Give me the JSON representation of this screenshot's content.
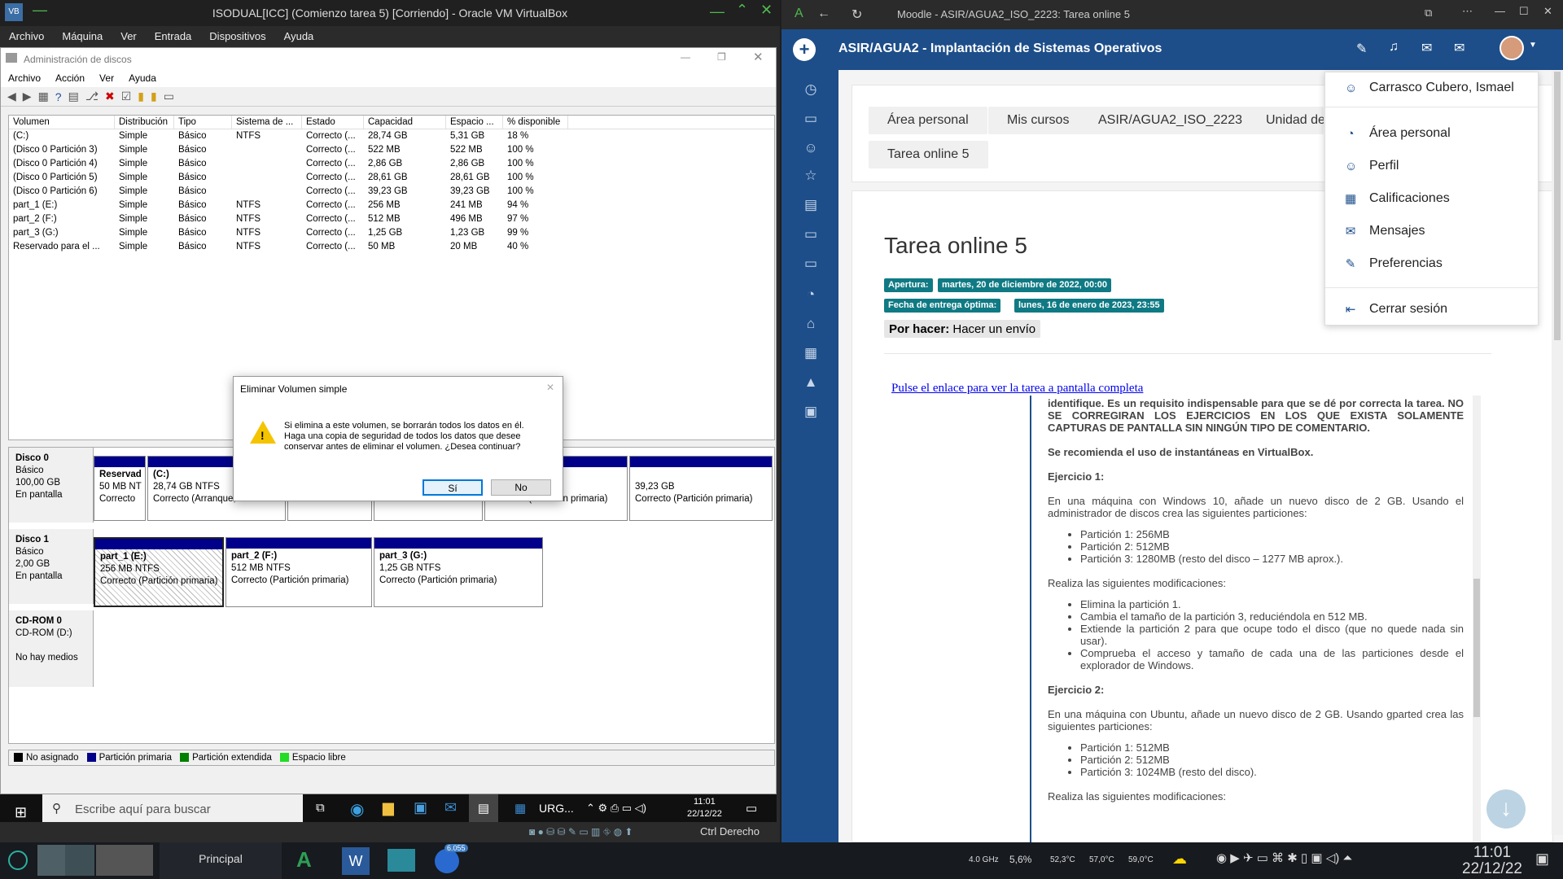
{
  "vbox": {
    "title": "ISODUAL[ICC] (Comienzo tarea 5) [Corriendo] - Oracle VM VirtualBox",
    "menu": [
      "Archivo",
      "Máquina",
      "Ver",
      "Entrada",
      "Dispositivos",
      "Ayuda"
    ],
    "host_key": "Ctrl Derecho"
  },
  "dm": {
    "title": "Administración de discos",
    "menu": [
      "Archivo",
      "Acción",
      "Ver",
      "Ayuda"
    ],
    "columns": [
      "Volumen",
      "Distribución",
      "Tipo",
      "Sistema de ...",
      "Estado",
      "Capacidad",
      "Espacio ...",
      "% disponible"
    ],
    "rows": [
      [
        "(C:)",
        "Simple",
        "Básico",
        "NTFS",
        "Correcto (...",
        "28,74 GB",
        "5,31 GB",
        "18 %"
      ],
      [
        "(Disco 0 Partición 3)",
        "Simple",
        "Básico",
        "",
        "Correcto (...",
        "522 MB",
        "522 MB",
        "100 %"
      ],
      [
        "(Disco 0 Partición 4)",
        "Simple",
        "Básico",
        "",
        "Correcto (...",
        "2,86 GB",
        "2,86 GB",
        "100 %"
      ],
      [
        "(Disco 0 Partición 5)",
        "Simple",
        "Básico",
        "",
        "Correcto (...",
        "28,61 GB",
        "28,61 GB",
        "100 %"
      ],
      [
        "(Disco 0 Partición 6)",
        "Simple",
        "Básico",
        "",
        "Correcto (...",
        "39,23 GB",
        "39,23 GB",
        "100 %"
      ],
      [
        "part_1 (E:)",
        "Simple",
        "Básico",
        "NTFS",
        "Correcto (...",
        "256 MB",
        "241 MB",
        "94 %"
      ],
      [
        "part_2 (F:)",
        "Simple",
        "Básico",
        "NTFS",
        "Correcto (...",
        "512 MB",
        "496 MB",
        "97 %"
      ],
      [
        "part_3 (G:)",
        "Simple",
        "Básico",
        "NTFS",
        "Correcto (...",
        "1,25 GB",
        "1,23 GB",
        "99 %"
      ],
      [
        "Reservado para el ...",
        "Simple",
        "Básico",
        "NTFS",
        "Correcto (...",
        "50 MB",
        "20 MB",
        "40 %"
      ]
    ],
    "disk0": {
      "name": "Disco 0",
      "type": "Básico",
      "size": "100,00 GB",
      "state": "En pantalla",
      "p_res": {
        "name": "Reservad",
        "size": "50 MB NT",
        "state": "Correcto"
      },
      "p_c": {
        "name": "(C:)",
        "size": "28,74 GB NTFS",
        "state": "Correcto (Arranque, ..."
      },
      "p_last": {
        "size": "39,23 GB",
        "state": "Correcto (Partición primaria)"
      },
      "p_mid_state": "Correcto (Partición primaria)"
    },
    "disk1": {
      "name": "Disco 1",
      "type": "Básico",
      "size": "2,00 GB",
      "state": "En pantalla",
      "parts": [
        {
          "name": "part_1 (E:)",
          "size": "256 MB NTFS",
          "state": "Correcto (Partición primaria)"
        },
        {
          "name": "part_2 (F:)",
          "size": "512 MB NTFS",
          "state": "Correcto (Partición primaria)"
        },
        {
          "name": "part_3 (G:)",
          "size": "1,25 GB NTFS",
          "state": "Correcto (Partición primaria)"
        }
      ]
    },
    "cdrom": {
      "name": "CD-ROM 0",
      "drive": "CD-ROM (D:)",
      "media": "No hay medios"
    },
    "legend": [
      "No asignado",
      "Partición primaria",
      "Partición extendida",
      "Espacio libre"
    ]
  },
  "dialog": {
    "title": "Eliminar Volumen simple",
    "line1": "Si elimina a este volumen, se borrarán todos los datos en él.",
    "line2": "Haga una copia de seguridad de todos los datos que desee",
    "line3": "conservar antes de eliminar el volumen. ¿Desea continuar?",
    "yes": "Sí",
    "no": "No"
  },
  "wintb": {
    "search_placeholder": "Escribe aquí para buscar",
    "app_label": "URG...",
    "time": "11:01",
    "date": "22/12/22"
  },
  "browser": {
    "title": "Moodle - ASIR/AGUA2_ISO_2223: Tarea online 5",
    "course": "ASIR/AGUA2 - Implantación de Sistemas Operativos",
    "crumbs": [
      "Área personal",
      "Mis cursos",
      "ASIR/AGUA2_ISO_2223",
      "Unidad de",
      "Tarea online 5"
    ],
    "heading": "Tarea online 5",
    "apertura_label": "Apertura:",
    "apertura_val": "martes, 20 de diciembre de 2022, 00:00",
    "entrega_label": "Fecha de entrega óptima:",
    "entrega_val": "lunes, 16 de enero de 2023, 23:55",
    "todo_label": "Por hacer:",
    "todo_val": "Hacer un envío",
    "link": "Pulse el enlace para ver la tarea a pantalla completa",
    "dropdown": {
      "user": "Carrasco Cubero, Ismael",
      "items": [
        "Área personal",
        "Perfil",
        "Calificaciones",
        "Mensajes",
        "Preferencias"
      ],
      "logout": "Cerrar sesión"
    }
  },
  "task": {
    "p0": "identifique. Es un requisito indispensable para que se dé por correcta la tarea. NO SE CORREGIRAN LOS EJERCICIOS EN LOS QUE EXISTA SOLAMENTE CAPTURAS DE PANTALLA SIN NINGÚN TIPO DE COMENTARIO.",
    "p1": "Se recomienda el uso de instantáneas en VirtualBox.",
    "ej1": "Ejercicio 1:",
    "ej1_text": "En una máquina con Windows 10, añade un nuevo disco de 2 GB. Usando el administrador de discos crea las siguientes particiones:",
    "ej1_list": [
      "Partición 1: 256MB",
      "Partición 2: 512MB",
      "Partición 3: 1280MB (resto del disco – 1277 MB aprox.)."
    ],
    "mods": "Realiza las siguientes modificaciones:",
    "mods_list": [
      "Elimina la partición 1.",
      "Cambia el tamaño de la partición 3, reduciéndola en 512 MB.",
      "Extiende la partición 2 para que ocupe todo el disco (que no quede nada sin usar).",
      "Comprueba el acceso y tamaño de cada una de las particiones desde el explorador de Windows."
    ],
    "ej2": "Ejercicio 2:",
    "ej2_text": "En una máquina con Ubuntu, añade un nuevo disco de 2 GB. Usando gparted crea las siguientes particiones:",
    "ej2_list": [
      "Partición 1: 512MB",
      "Partición 2: 512MB",
      "Partición 3: 1024MB (resto del disco)."
    ],
    "mods2": "Realiza las siguientes modificaciones:"
  },
  "hostbar": {
    "desktop": "Principal",
    "cpu_freq": "4.0 GHz",
    "cpu": "5,6%",
    "t1": "52,3°C",
    "t2": "57,0°C",
    "t3": "59,0°C",
    "time": "11:01",
    "date": "22/12/22",
    "badge": "6.055"
  }
}
